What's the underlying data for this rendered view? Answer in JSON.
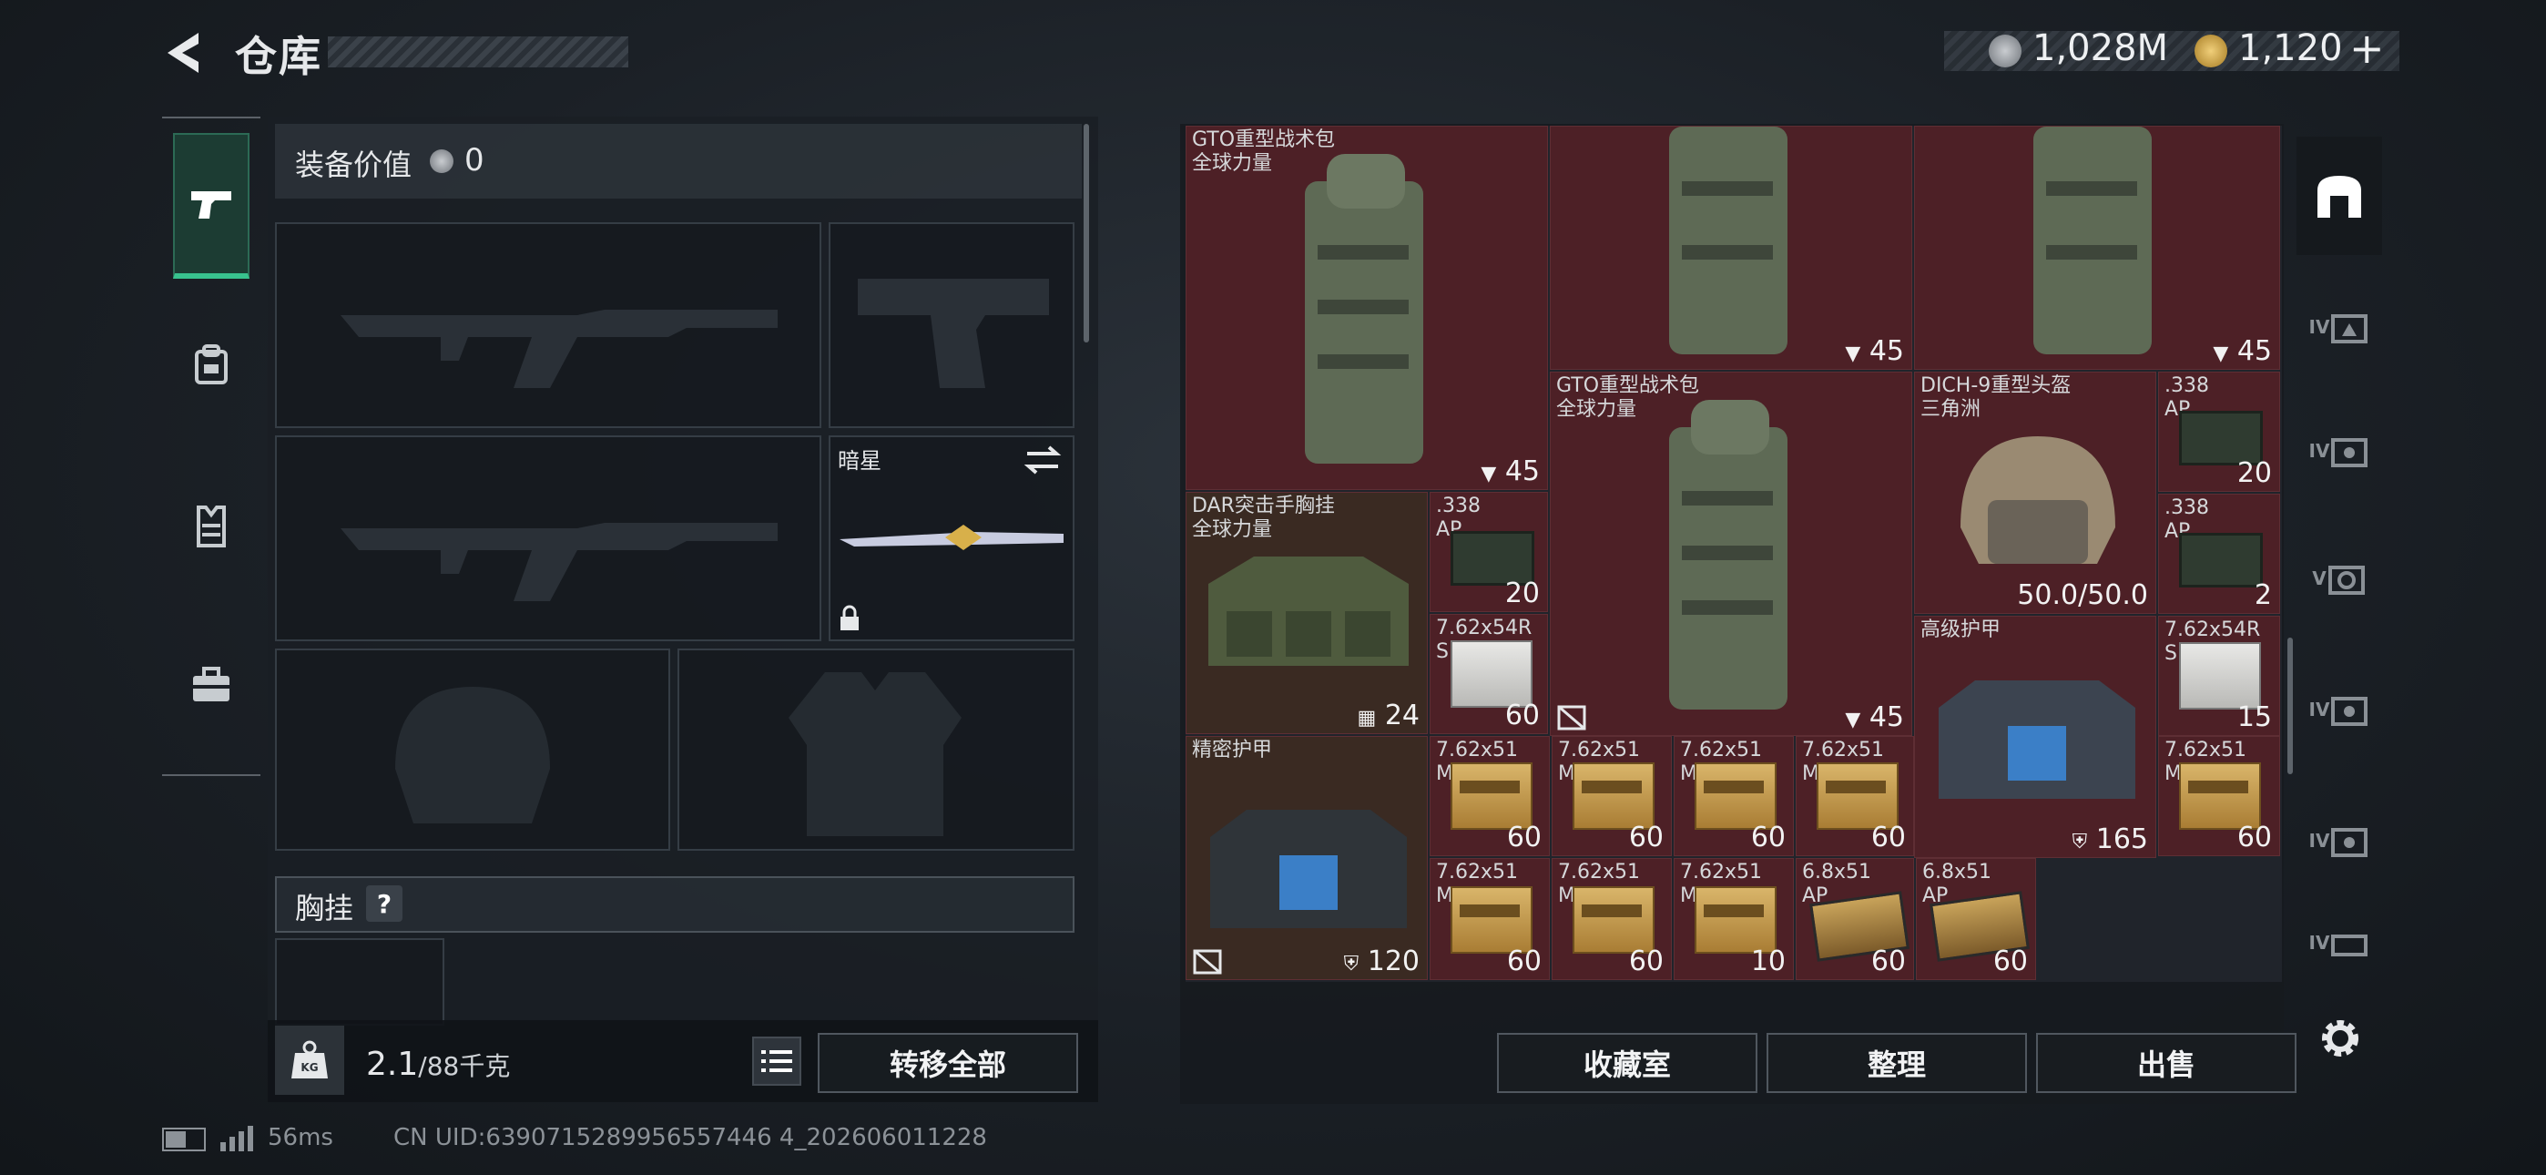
{
  "header": {
    "title": "仓库"
  },
  "currency": {
    "coins": "1,028M",
    "gems": "1,120",
    "gems_add": "+"
  },
  "equipment": {
    "value_label": "装备价值",
    "value": "0",
    "melee_name": "暗星",
    "chest_label": "胸挂",
    "chest_help": "?",
    "weight_current": "2.1",
    "weight_max": "/88千克",
    "transfer_all": "转移全部"
  },
  "stash": {
    "items": [
      {
        "name": "GTO重型战术包\n全球力量",
        "count": "45"
      },
      {
        "count": "45"
      },
      {
        "count": "45"
      },
      {
        "name": "GTO重型战术包\n全球力量",
        "count": "45"
      },
      {
        "name": "DICH-9重型头盔\n三角洲",
        "count": "50.0/50.0"
      },
      {
        "name": ".338\nAP",
        "count": "20"
      },
      {
        "name": "DAR突击手胸挂\n全球力量",
        "count": "24"
      },
      {
        "name": ".338\nAP",
        "count": "20"
      },
      {
        "name": ".338\nAP",
        "count": "2"
      },
      {
        "name": "7.62x54R\nSNB",
        "count": "60"
      },
      {
        "name": "高级护甲",
        "count": "165"
      },
      {
        "name": "7.62x54R\nSNB",
        "count": "15"
      },
      {
        "name": "精密护甲",
        "count": "120"
      },
      {
        "name": "7.62x51\nM61",
        "count": "60"
      },
      {
        "name": "7.62x51\nM61",
        "count": "60"
      },
      {
        "name": "7.62x51\nM61",
        "count": "60"
      },
      {
        "name": "7.62x51\nM61",
        "count": "60"
      },
      {
        "name": "7.62x51\nM61",
        "count": "60"
      },
      {
        "name": "7.62x51\nM61",
        "count": "60"
      },
      {
        "name": "7.62x51\nM61",
        "count": "60"
      },
      {
        "name": "7.62x51\nM61",
        "count": "10"
      },
      {
        "name": "6.8x51\nAP",
        "count": "60"
      },
      {
        "name": "6.8x51\nAP",
        "count": "60"
      }
    ],
    "buttons": {
      "collection": "收藏室",
      "sort": "整理",
      "sell": "出售"
    },
    "side_tabs": [
      "IV",
      "IV",
      "V",
      "IV",
      "IV",
      "IV"
    ]
  },
  "status": {
    "ping": "56ms",
    "uid": "CN UID:6390715289956557446 4_202606011228"
  }
}
